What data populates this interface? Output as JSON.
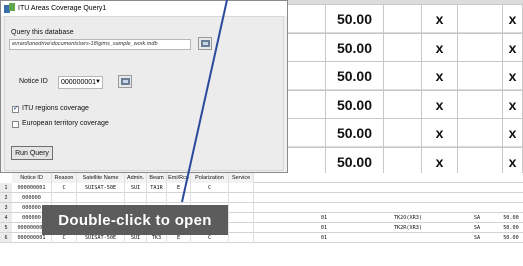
{
  "dialog": {
    "title": "ITU Areas Coverage Query1",
    "query_label": "Query this database",
    "db_path": "evrard\\onedrive\\documents\\wrs-18\\gims_sample_work.mdb",
    "notice_label": "Notice ID",
    "notice_value": "000000001",
    "itu_regions_label": "ITU regions coverage",
    "itu_regions_checked": true,
    "european_label": "European territory coverage",
    "european_checked": false,
    "run_label": "Run Query"
  },
  "zoom_values": [
    {
      "val": "50.00",
      "x1": "x",
      "x2": "x"
    },
    {
      "val": "50.00",
      "x1": "x",
      "x2": "x"
    },
    {
      "val": "50.00",
      "x1": "x",
      "x2": "x"
    },
    {
      "val": "50.00",
      "x1": "x",
      "x2": "x"
    },
    {
      "val": "50.00",
      "x1": "x",
      "x2": "x"
    },
    {
      "val": "50.00",
      "x1": "x",
      "x2": "x"
    }
  ],
  "grid": {
    "headers": [
      "Notice ID",
      "Reason",
      "Satellite Name",
      "Admin.",
      "Beam",
      "Emi/Rcp",
      "Polarization",
      "Service"
    ],
    "rows": [
      {
        "n": "1",
        "c": [
          "000000001",
          "C",
          "SUISAT-50E",
          "SUI",
          "TA1R",
          "E",
          "C",
          ""
        ]
      },
      {
        "n": "2",
        "c": [
          "000000",
          "",
          "",
          "",
          "",
          "",
          "",
          ""
        ]
      },
      {
        "n": "3",
        "c": [
          "000000",
          "",
          "",
          "",
          "",
          "",
          "",
          ""
        ]
      },
      {
        "n": "4",
        "c": [
          "000000",
          "",
          "",
          "",
          "",
          "",
          "",
          ""
        ],
        "extra": [
          "01",
          "TK2O(XR3)",
          "SA",
          "50.00",
          "x",
          "",
          "x"
        ]
      },
      {
        "n": "5",
        "c": [
          "000000001",
          "C",
          "SUISAT-50E",
          "SUI",
          "TK2R",
          "E",
          "C",
          ""
        ],
        "extra": [
          "01",
          "TK2R(XR3)",
          "SA",
          "50.00",
          "x",
          "",
          "x"
        ]
      },
      {
        "n": "6",
        "c": [
          "000000001",
          "C",
          "SUISAT-50E",
          "SUI",
          "TK3",
          "E",
          "C",
          ""
        ],
        "extra": [
          "01",
          "",
          "SA",
          "50.00",
          "x",
          "",
          "x"
        ]
      }
    ]
  },
  "tooltip": "Double-click to open",
  "colors": {
    "tooltip_bg": "#5c5c5c",
    "callout": "#2b4a9c"
  }
}
